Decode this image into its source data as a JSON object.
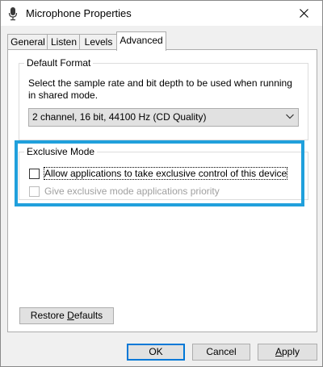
{
  "window": {
    "title": "Microphone Properties",
    "title_icon": "microphone-icon",
    "close_icon": "close-icon"
  },
  "tabs": [
    {
      "label": "General",
      "active": false
    },
    {
      "label": "Listen",
      "active": false
    },
    {
      "label": "Levels",
      "active": false
    },
    {
      "label": "Advanced",
      "active": true
    }
  ],
  "default_format": {
    "label": "Default Format",
    "description": "Select the sample rate and bit depth to be used when running in shared mode.",
    "selected": "2 channel, 16 bit, 44100 Hz (CD Quality)"
  },
  "exclusive_mode": {
    "label": "Exclusive Mode",
    "allow_label": "Allow applications to take exclusive control of this device",
    "allow_checked": false,
    "priority_label": "Give exclusive mode applications priority",
    "priority_checked": false,
    "priority_enabled": false,
    "highlight_color": "#20a0dc"
  },
  "buttons": {
    "restore_defaults_pre": "Restore ",
    "restore_defaults_u": "D",
    "restore_defaults_post": "efaults",
    "ok": "OK",
    "cancel": "Cancel",
    "apply_u": "A",
    "apply_post": "pply"
  }
}
